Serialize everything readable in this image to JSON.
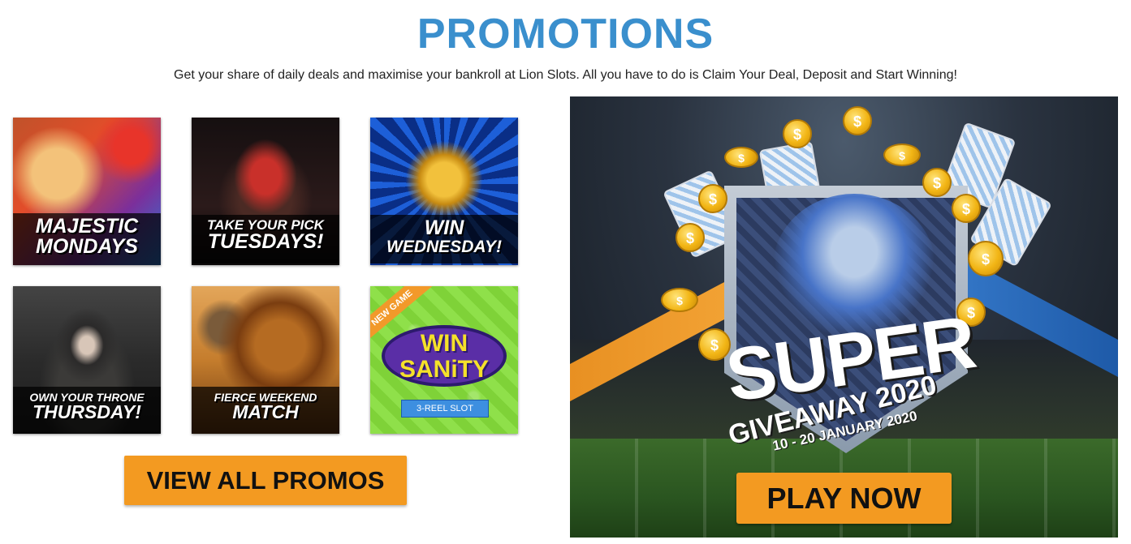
{
  "header": {
    "title": "PROMOTIONS",
    "subtitle": "Get your share of daily deals and maximise your bankroll at Lion Slots. All you have to do is Claim Your Deal, Deposit and Start Winning!"
  },
  "promos": [
    {
      "line1": "MAJESTIC",
      "line2": "MONDAYS"
    },
    {
      "line1": "TAKE YOUR PICK",
      "line2": "TUESDAYS!"
    },
    {
      "line1": "WIN",
      "line2": "WEDNESDAY!"
    },
    {
      "line1": "OWN YOUR THRONE",
      "line2": "THURSDAY!"
    },
    {
      "line1": "FIERCE WEEKEND",
      "line2": "MATCH"
    },
    {
      "ribbon": "NEW GAME",
      "logo_line1": "WIN",
      "logo_line2": "SANiTY",
      "tag": "3-REEL SLOT"
    }
  ],
  "view_all_button": "VIEW ALL PROMOS",
  "banner": {
    "title": "SUPER",
    "subtitle": "GIVEAWAY 2020",
    "dates": "10 - 20 JANUARY 2020",
    "cta": "PLAY NOW",
    "coin_symbol": "$"
  }
}
